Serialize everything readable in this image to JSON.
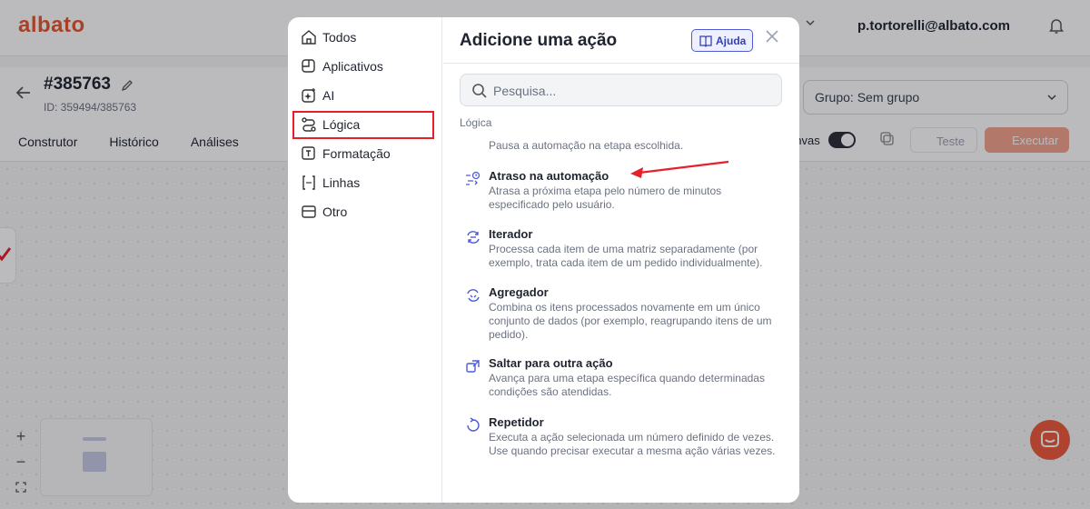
{
  "app": {
    "logo": "albato",
    "user_email": "p.tortorelli@albato.com"
  },
  "automation": {
    "title": "#385763",
    "id_label": "ID: 359494/385763"
  },
  "tabs": [
    "Construtor",
    "Histórico",
    "Análises"
  ],
  "toolbar": {
    "group_select": "Grupo: Sem grupo",
    "canvas_label": "anvas",
    "test_label": "Teste",
    "run_label": "Executar"
  },
  "zoom": {
    "in": "+",
    "out": "−"
  },
  "modal": {
    "title": "Adicione uma ação",
    "help_label": "Ajuda",
    "search_placeholder": "Pesquisa...",
    "section_label": "Lógica",
    "sidebar": [
      {
        "label": "Todos",
        "icon": "home-icon"
      },
      {
        "label": "Aplicativos",
        "icon": "apps-icon"
      },
      {
        "label": "AI",
        "icon": "sparkle-icon"
      },
      {
        "label": "Lógica",
        "icon": "route-icon",
        "selected": true
      },
      {
        "label": "Formatação",
        "icon": "format-icon"
      },
      {
        "label": "Linhas",
        "icon": "brackets-icon"
      },
      {
        "label": "Otro",
        "icon": "box-icon"
      }
    ],
    "first_desc": "Pausa a automação na etapa escolhida.",
    "actions": [
      {
        "title": "Atraso na automação",
        "desc": "Atrasa a próxima etapa pelo número de minutos especificado pelo usuário.",
        "icon": "delay-icon"
      },
      {
        "title": "Iterador",
        "desc": "Processa cada item de uma matriz separadamente (por exemplo, trata cada item de um pedido individualmente).",
        "icon": "iterator-icon"
      },
      {
        "title": "Agregador",
        "desc": "Combina os itens processados novamente em um único conjunto de dados (por exemplo, reagrupando itens de um pedido).",
        "icon": "aggregator-icon"
      },
      {
        "title": "Saltar para outra ação",
        "desc": "Avança para uma etapa específica quando determinadas condições são atendidas.",
        "icon": "jump-icon"
      },
      {
        "title": "Repetidor",
        "desc": "Executa a ação selecionada um número definido de vezes. Use quando precisar executar a mesma ação várias vezes.",
        "icon": "repeat-icon"
      }
    ]
  },
  "colors": {
    "brand": "#e8552d",
    "accent": "#4f5bd5",
    "highlight": "#e5202b"
  }
}
